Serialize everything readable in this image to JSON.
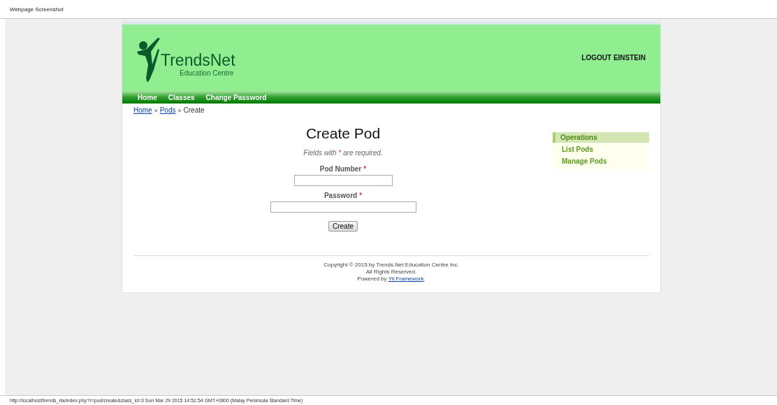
{
  "window": {
    "title": "Webpage Screenshot"
  },
  "header": {
    "brand": "TrendsNet",
    "tagline": "Education Centre",
    "logout": "LOGOUT EINSTEIN"
  },
  "menu": [
    {
      "label": "Home"
    },
    {
      "label": "Classes"
    },
    {
      "label": "Change Password"
    }
  ],
  "breadcrumbs": [
    {
      "label": "Home",
      "link": true
    },
    {
      "label": "Pods",
      "link": true
    },
    {
      "label": "Create",
      "link": false
    }
  ],
  "breadcrumb_separator": "»",
  "form": {
    "title": "Create Pod",
    "note_before": "Fields with",
    "note_mark": "*",
    "note_after": "are required.",
    "fields": [
      {
        "label": "Pod Number",
        "required_mark": "*",
        "kind": "short"
      },
      {
        "label": "Password",
        "required_mark": "*",
        "kind": "long"
      }
    ],
    "submit": "Create"
  },
  "sidebar": {
    "title": "Operations",
    "items": [
      {
        "label": "List Pods"
      },
      {
        "label": "Manage Pods"
      }
    ]
  },
  "footer": {
    "copyright": "Copyright © 2015 by Trends.Net Education Centre Inc.",
    "rights": "All Rights Reserved.",
    "powered_before": "Powered by",
    "powered_link": "Yii Framework",
    "powered_after": "."
  },
  "status_bar": {
    "text": "http://localhost/trends_rla/index.php?r=pod/create&class_id=3 Sun Mar 29 2015 14:51:54 GMT+0800 (Malay Peninsula Standard Time)"
  }
}
